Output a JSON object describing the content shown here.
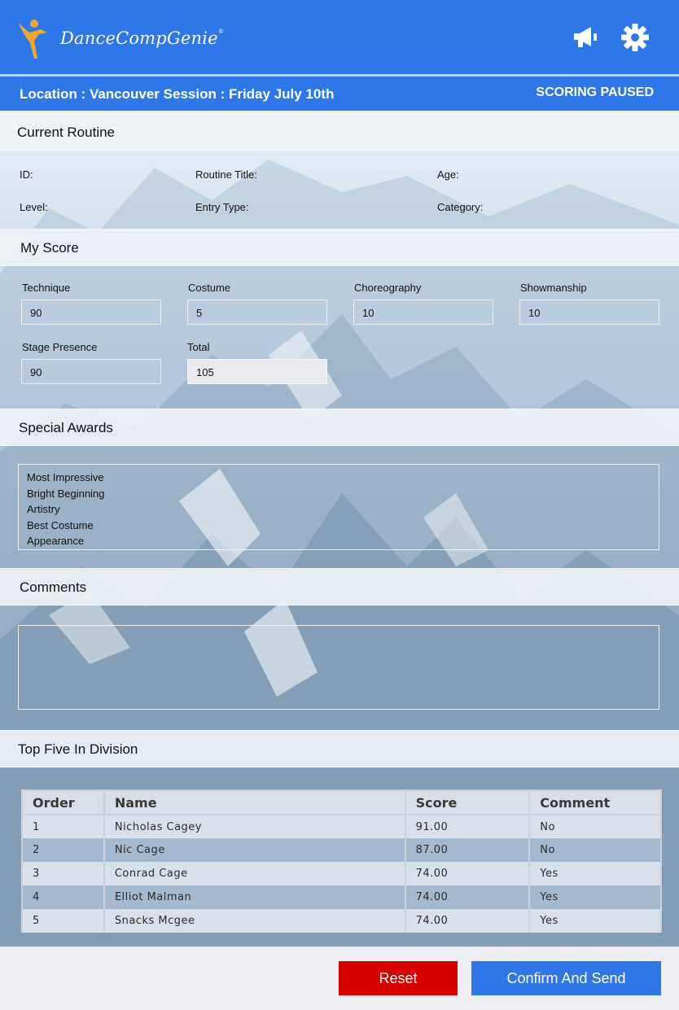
{
  "app": {
    "name": "DanceCompGenie",
    "trademark": "®",
    "brand_color": "#2e77e8"
  },
  "header": {
    "icons": [
      "megaphone-icon",
      "gear-icon"
    ]
  },
  "infobar": {
    "location_session": "Location : Vancouver  Session : Friday July 10th",
    "status": "SCORING PAUSED"
  },
  "current_routine": {
    "heading": "Current Routine",
    "id_label": "ID:",
    "title_label": "Routine Title:",
    "age_label": "Age:",
    "level_label": "Level:",
    "entry_type_label": "Entry Type:",
    "category_label": "Category:"
  },
  "my_score": {
    "heading": "My Score",
    "technique": {
      "label": "Technique",
      "value": "90"
    },
    "costume": {
      "label": "Costume",
      "value": "5"
    },
    "choreography": {
      "label": "Choreography",
      "value": "10"
    },
    "showmanship": {
      "label": "Showmanship",
      "value": "10"
    },
    "stage_presence": {
      "label": "Stage Presence",
      "value": "90"
    },
    "total": {
      "label": "Total",
      "value": "105"
    }
  },
  "special_awards": {
    "heading": "Special Awards",
    "items": [
      "Most Impressive",
      "Bright Beginning",
      "Artistry",
      "Best Costume",
      "Appearance"
    ]
  },
  "comments": {
    "heading": "Comments",
    "value": ""
  },
  "top_five": {
    "heading": "Top Five In Division",
    "columns": [
      "Order",
      "Name",
      "Score",
      "Comment"
    ],
    "rows": [
      [
        "1",
        "Nicholas Cagey",
        "91.00",
        "No"
      ],
      [
        "2",
        "Nic Cage",
        "87.00",
        "No"
      ],
      [
        "3",
        "Conrad Cage",
        "74.00",
        "Yes"
      ],
      [
        "4",
        "Elliot Malman",
        "74.00",
        "Yes"
      ],
      [
        "5",
        "Snacks Mcgee",
        "74.00",
        "Yes"
      ]
    ]
  },
  "actions": {
    "reset_label": "Reset",
    "reset_color": "#d90000",
    "confirm_label": "Confirm And Send"
  }
}
